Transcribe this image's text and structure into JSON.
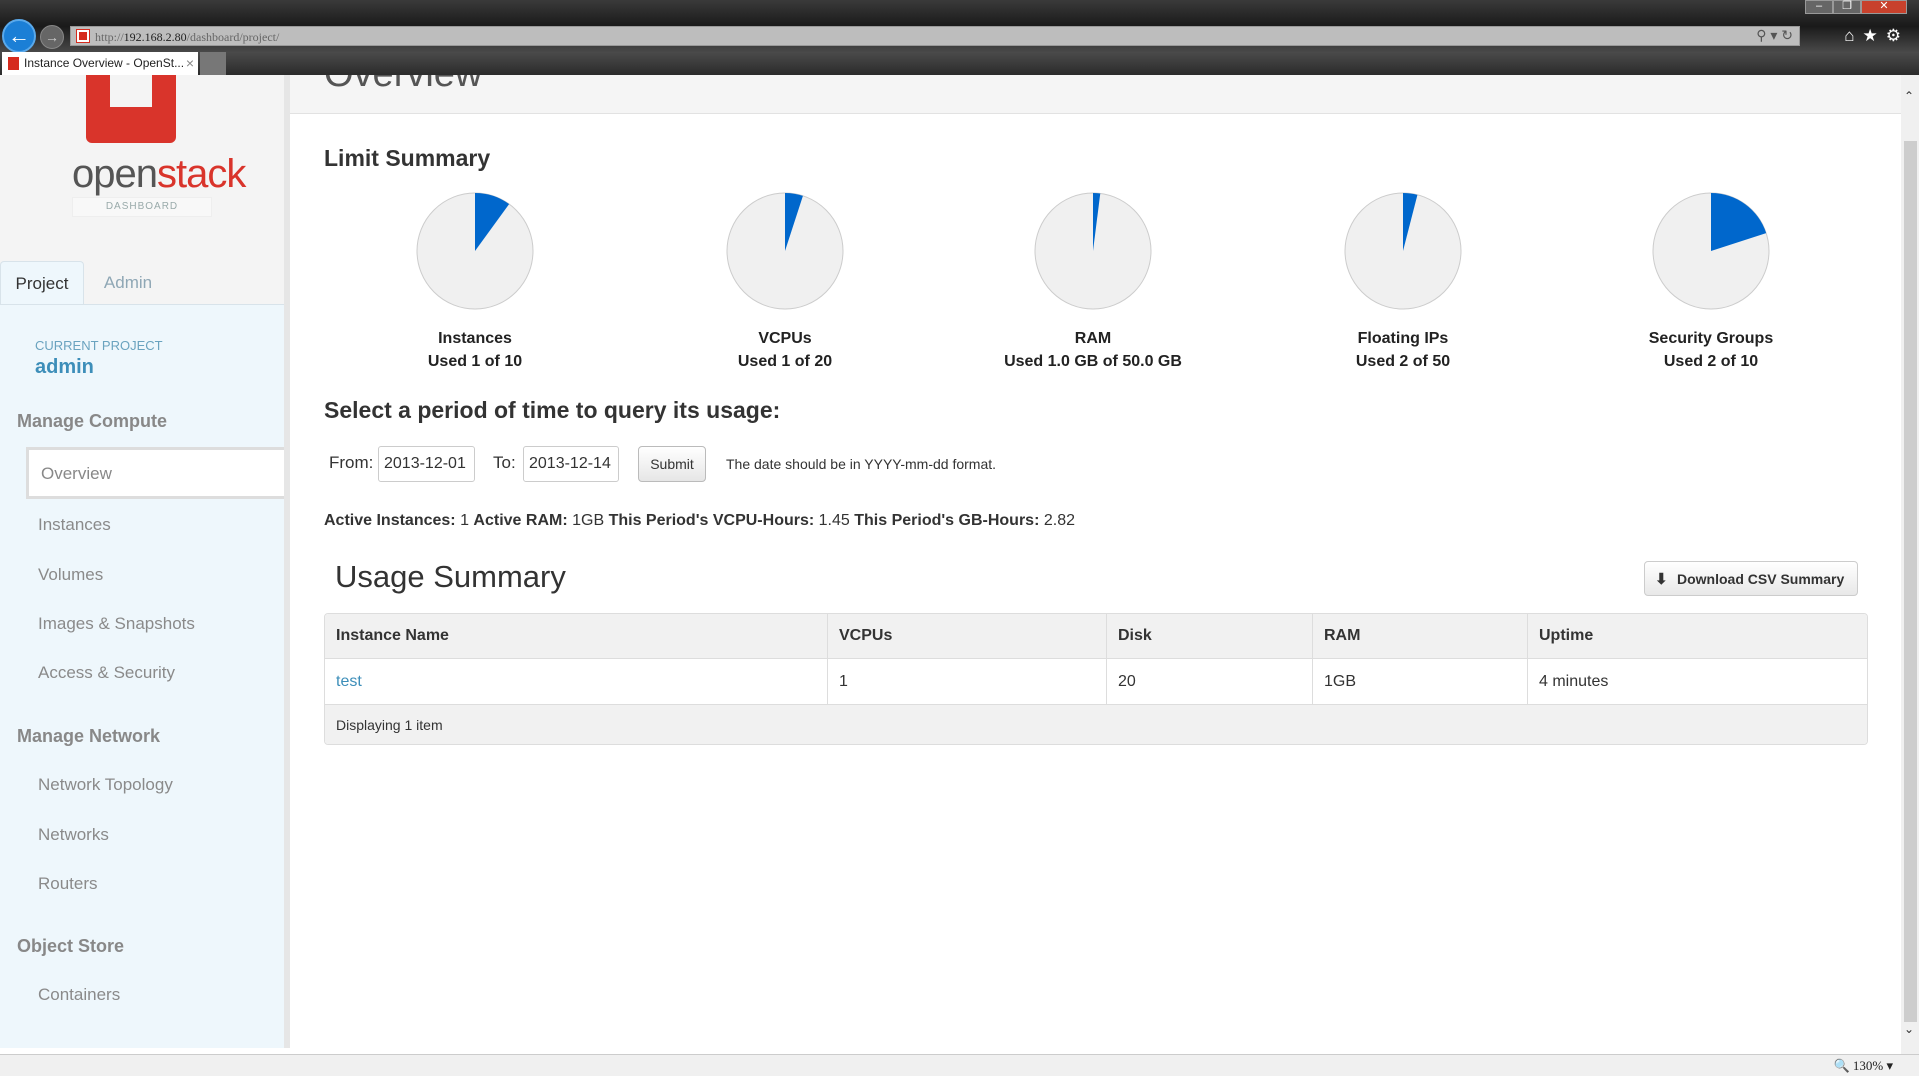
{
  "browser": {
    "url_prefix": "http://",
    "url_host": "192.168.2.80",
    "url_path": "/dashboard/project/",
    "tab_title": "Instance Overview - OpenSt...",
    "zoom_level": "130%"
  },
  "sidebar": {
    "logo_text_a": "open",
    "logo_text_b": "stack",
    "logo_sub": "DASHBOARD",
    "tabs": [
      {
        "label": "Project"
      },
      {
        "label": "Admin"
      }
    ],
    "current_project_label": "CURRENT PROJECT",
    "current_project": "admin",
    "sections": [
      {
        "title": "Manage Compute",
        "items": [
          "Overview",
          "Instances",
          "Volumes",
          "Images & Snapshots",
          "Access & Security"
        ]
      },
      {
        "title": "Manage Network",
        "items": [
          "Network Topology",
          "Networks",
          "Routers"
        ]
      },
      {
        "title": "Object Store",
        "items": [
          "Containers"
        ]
      }
    ]
  },
  "main": {
    "page_title": "Overview",
    "limit_title": "Limit Summary",
    "accent_color": "#0067cc",
    "limits": [
      {
        "name": "Instances",
        "text": "Used 1 of 10",
        "used": 1,
        "limit": 10
      },
      {
        "name": "VCPUs",
        "text": "Used 1 of 20",
        "used": 1,
        "limit": 20
      },
      {
        "name": "RAM",
        "text": "Used 1.0 GB of 50.0 GB",
        "used": 1.0,
        "limit": 50.0
      },
      {
        "name": "Floating IPs",
        "text": "Used 2 of 50",
        "used": 2,
        "limit": 50
      },
      {
        "name": "Security Groups",
        "text": "Used 2 of 10",
        "used": 2,
        "limit": 10
      }
    ],
    "period_title": "Select a period of time to query its usage:",
    "from_label": "From:",
    "from_value": "2013-12-01",
    "to_label": "To:",
    "to_value": "2013-12-14",
    "submit_label": "Submit",
    "date_hint": "The date should be in YYYY-mm-dd format.",
    "stats": {
      "active_instances_label": "Active Instances:",
      "active_instances": "1",
      "active_ram_label": "Active RAM:",
      "active_ram": "1GB",
      "vcpu_hours_label": "This Period's VCPU-Hours:",
      "vcpu_hours": "1.45",
      "gb_hours_label": "This Period's GB-Hours:",
      "gb_hours": "2.82"
    },
    "usage_title": "Usage Summary",
    "download_label": "Download CSV Summary",
    "table": {
      "columns": [
        "Instance Name",
        "VCPUs",
        "Disk",
        "RAM",
        "Uptime"
      ],
      "rows": [
        [
          "test",
          "1",
          "20",
          "1GB",
          "4 minutes"
        ]
      ],
      "footer": "Displaying 1 item"
    }
  }
}
